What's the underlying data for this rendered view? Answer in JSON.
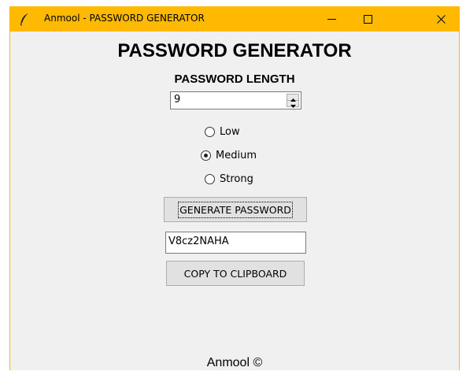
{
  "window": {
    "title": "Anmool - PASSWORD GENERATOR"
  },
  "app": {
    "heading": "PASSWORD GENERATOR",
    "length_label": "PASSWORD LENGTH",
    "length_value": "9",
    "strength_options": [
      {
        "label": "Low",
        "selected": false
      },
      {
        "label": "Medium",
        "selected": true
      },
      {
        "label": "Strong",
        "selected": false
      }
    ],
    "generate_label": "GENERATE PASSWORD",
    "password_value": "V8cz2NAHA",
    "copy_label": "COPY TO CLIPBOARD",
    "footer": "Anmool ©"
  },
  "colors": {
    "titlebar": "#ffb900",
    "window_bg": "#f0f0f0"
  },
  "icons": {
    "app": "feather-icon",
    "minimize": "minimize-icon",
    "maximize": "maximize-icon",
    "close": "close-icon"
  }
}
